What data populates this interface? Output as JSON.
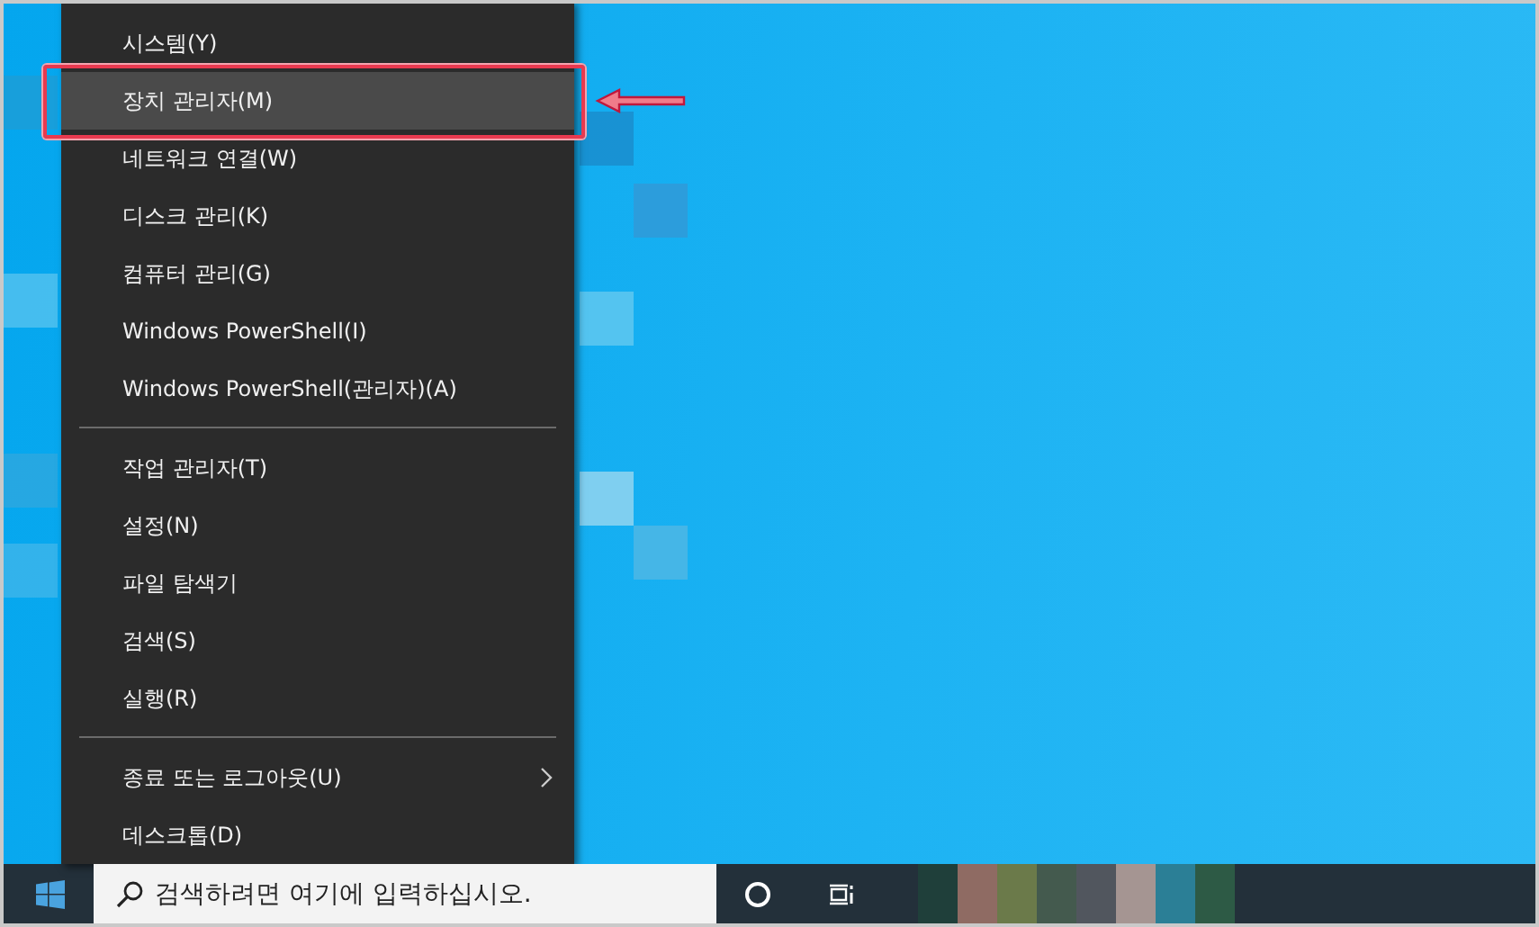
{
  "menu": {
    "items": [
      {
        "kind": "item",
        "label": "시스템(Y)",
        "selected": false,
        "submenu": false
      },
      {
        "kind": "item",
        "label": "장치 관리자(M)",
        "selected": true,
        "submenu": false
      },
      {
        "kind": "item",
        "label": "네트워크 연결(W)",
        "selected": false,
        "submenu": false
      },
      {
        "kind": "item",
        "label": "디스크 관리(K)",
        "selected": false,
        "submenu": false
      },
      {
        "kind": "item",
        "label": "컴퓨터 관리(G)",
        "selected": false,
        "submenu": false
      },
      {
        "kind": "item",
        "label": "Windows PowerShell(I)",
        "selected": false,
        "submenu": false
      },
      {
        "kind": "item",
        "label": "Windows PowerShell(관리자)(A)",
        "selected": false,
        "submenu": false
      },
      {
        "kind": "separator"
      },
      {
        "kind": "item",
        "label": "작업 관리자(T)",
        "selected": false,
        "submenu": false
      },
      {
        "kind": "item",
        "label": "설정(N)",
        "selected": false,
        "submenu": false
      },
      {
        "kind": "item",
        "label": "파일 탐색기",
        "selected": false,
        "submenu": false
      },
      {
        "kind": "item",
        "label": "검색(S)",
        "selected": false,
        "submenu": false
      },
      {
        "kind": "item",
        "label": "실행(R)",
        "selected": false,
        "submenu": false
      },
      {
        "kind": "separator"
      },
      {
        "kind": "item",
        "label": "종료 또는 로그아웃(U)",
        "selected": false,
        "submenu": true
      },
      {
        "kind": "item",
        "label": "데스크톱(D)",
        "selected": false,
        "submenu": false
      }
    ]
  },
  "taskbar": {
    "search": {
      "placeholder": "검색하려면 여기에 입력하십시오."
    }
  }
}
